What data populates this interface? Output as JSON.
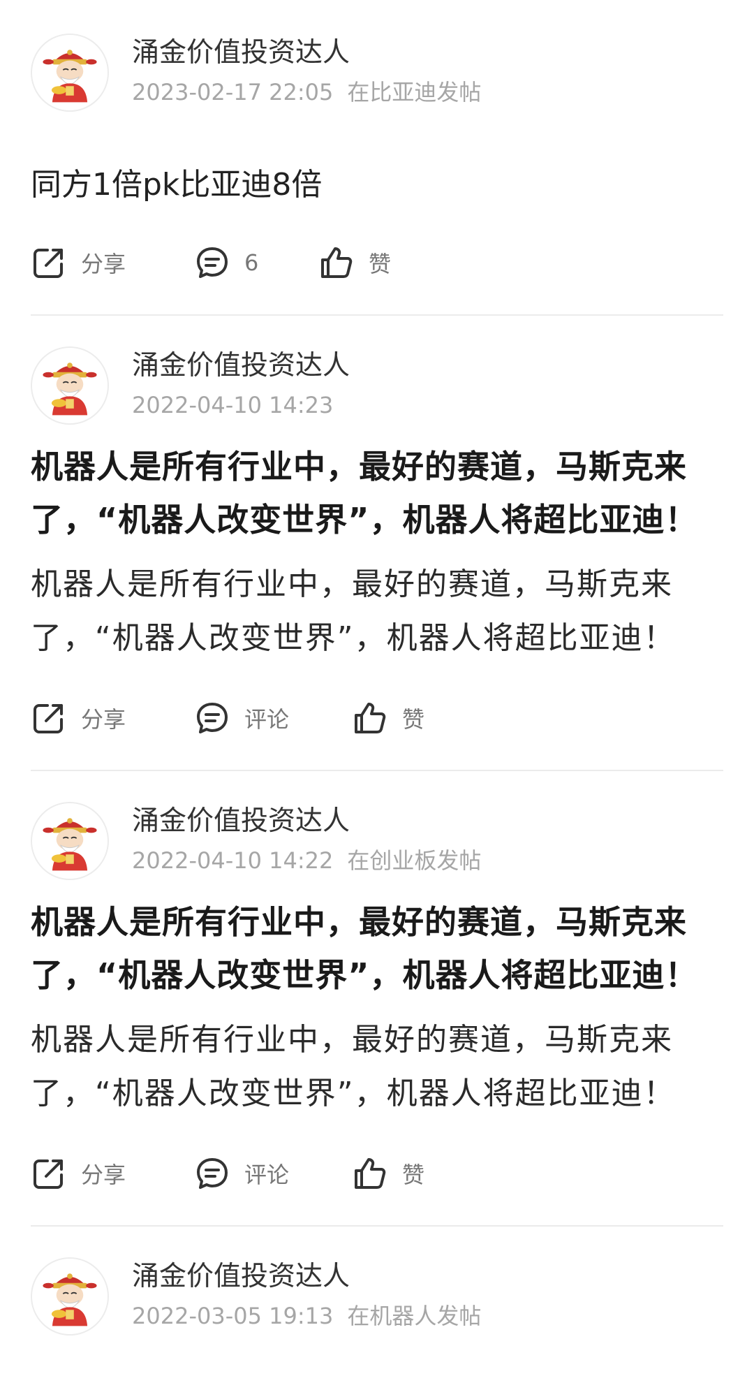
{
  "posts": [
    {
      "author": "涌金价值投资达人",
      "time": "2023-02-17 22:05",
      "board": "在比亚迪发帖",
      "content": "同方1倍pk比亚迪8倍",
      "share_label": "分享",
      "comment_label": "6",
      "like_label": "赞"
    },
    {
      "author": "涌金价值投资达人",
      "time": "2022-04-10 14:23",
      "title": "机器人是所有行业中，最好的赛道，马斯克来了，“机器人改变世界”，机器人将超比亚迪！",
      "excerpt": "机器人是所有行业中，最好的赛道，马斯克来了，“机器人改变世界”，机器人将超比亚迪！",
      "share_label": "分享",
      "comment_label": "评论",
      "like_label": "赞"
    },
    {
      "author": "涌金价值投资达人",
      "time": "2022-04-10 14:22",
      "board": "在创业板发帖",
      "title": "机器人是所有行业中，最好的赛道，马斯克来了，“机器人改变世界”，机器人将超比亚迪！",
      "excerpt": "机器人是所有行业中，最好的赛道，马斯克来了，“机器人改变世界”，机器人将超比亚迪！",
      "share_label": "分享",
      "comment_label": "评论",
      "like_label": "赞"
    },
    {
      "author": "涌金价值投资达人",
      "time": "2022-03-05 19:13",
      "board": "在机器人发帖"
    }
  ],
  "colors": {
    "meta_text": "#a6a6a6",
    "action_text": "#777777",
    "divider": "#ebebeb"
  },
  "icons": {
    "share": "share-icon",
    "comment": "comment-icon",
    "like": "thumbs-up-icon"
  }
}
